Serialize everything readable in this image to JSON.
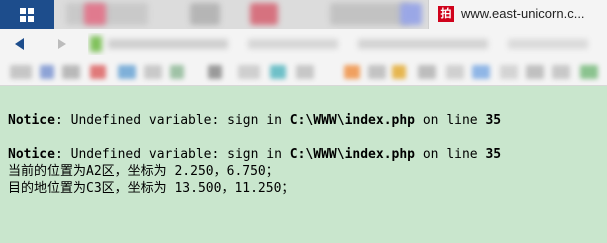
{
  "browser": {
    "active_tab": {
      "favicon_glyph": "拍",
      "favicon_color": "#d0021b",
      "title": "www.east-unicorn.c..."
    },
    "window_button_color": "#1d4d8c"
  },
  "page": {
    "background": "#c9e6cd",
    "notices": [
      {
        "label": "Notice",
        "message": ": Undefined variable: sign in ",
        "file": "C:\\WWW\\index.php",
        "on_line_text": " on line ",
        "line_number": "35"
      },
      {
        "label": "Notice",
        "message": ": Undefined variable: sign in ",
        "file": "C:\\WWW\\index.php",
        "on_line_text": " on line ",
        "line_number": "35"
      }
    ],
    "output_lines": [
      "当前的位置为A2区，坐标为 2.250，6.750；",
      "目的地位置为C3区，坐标为 13.500，11.250；"
    ]
  }
}
